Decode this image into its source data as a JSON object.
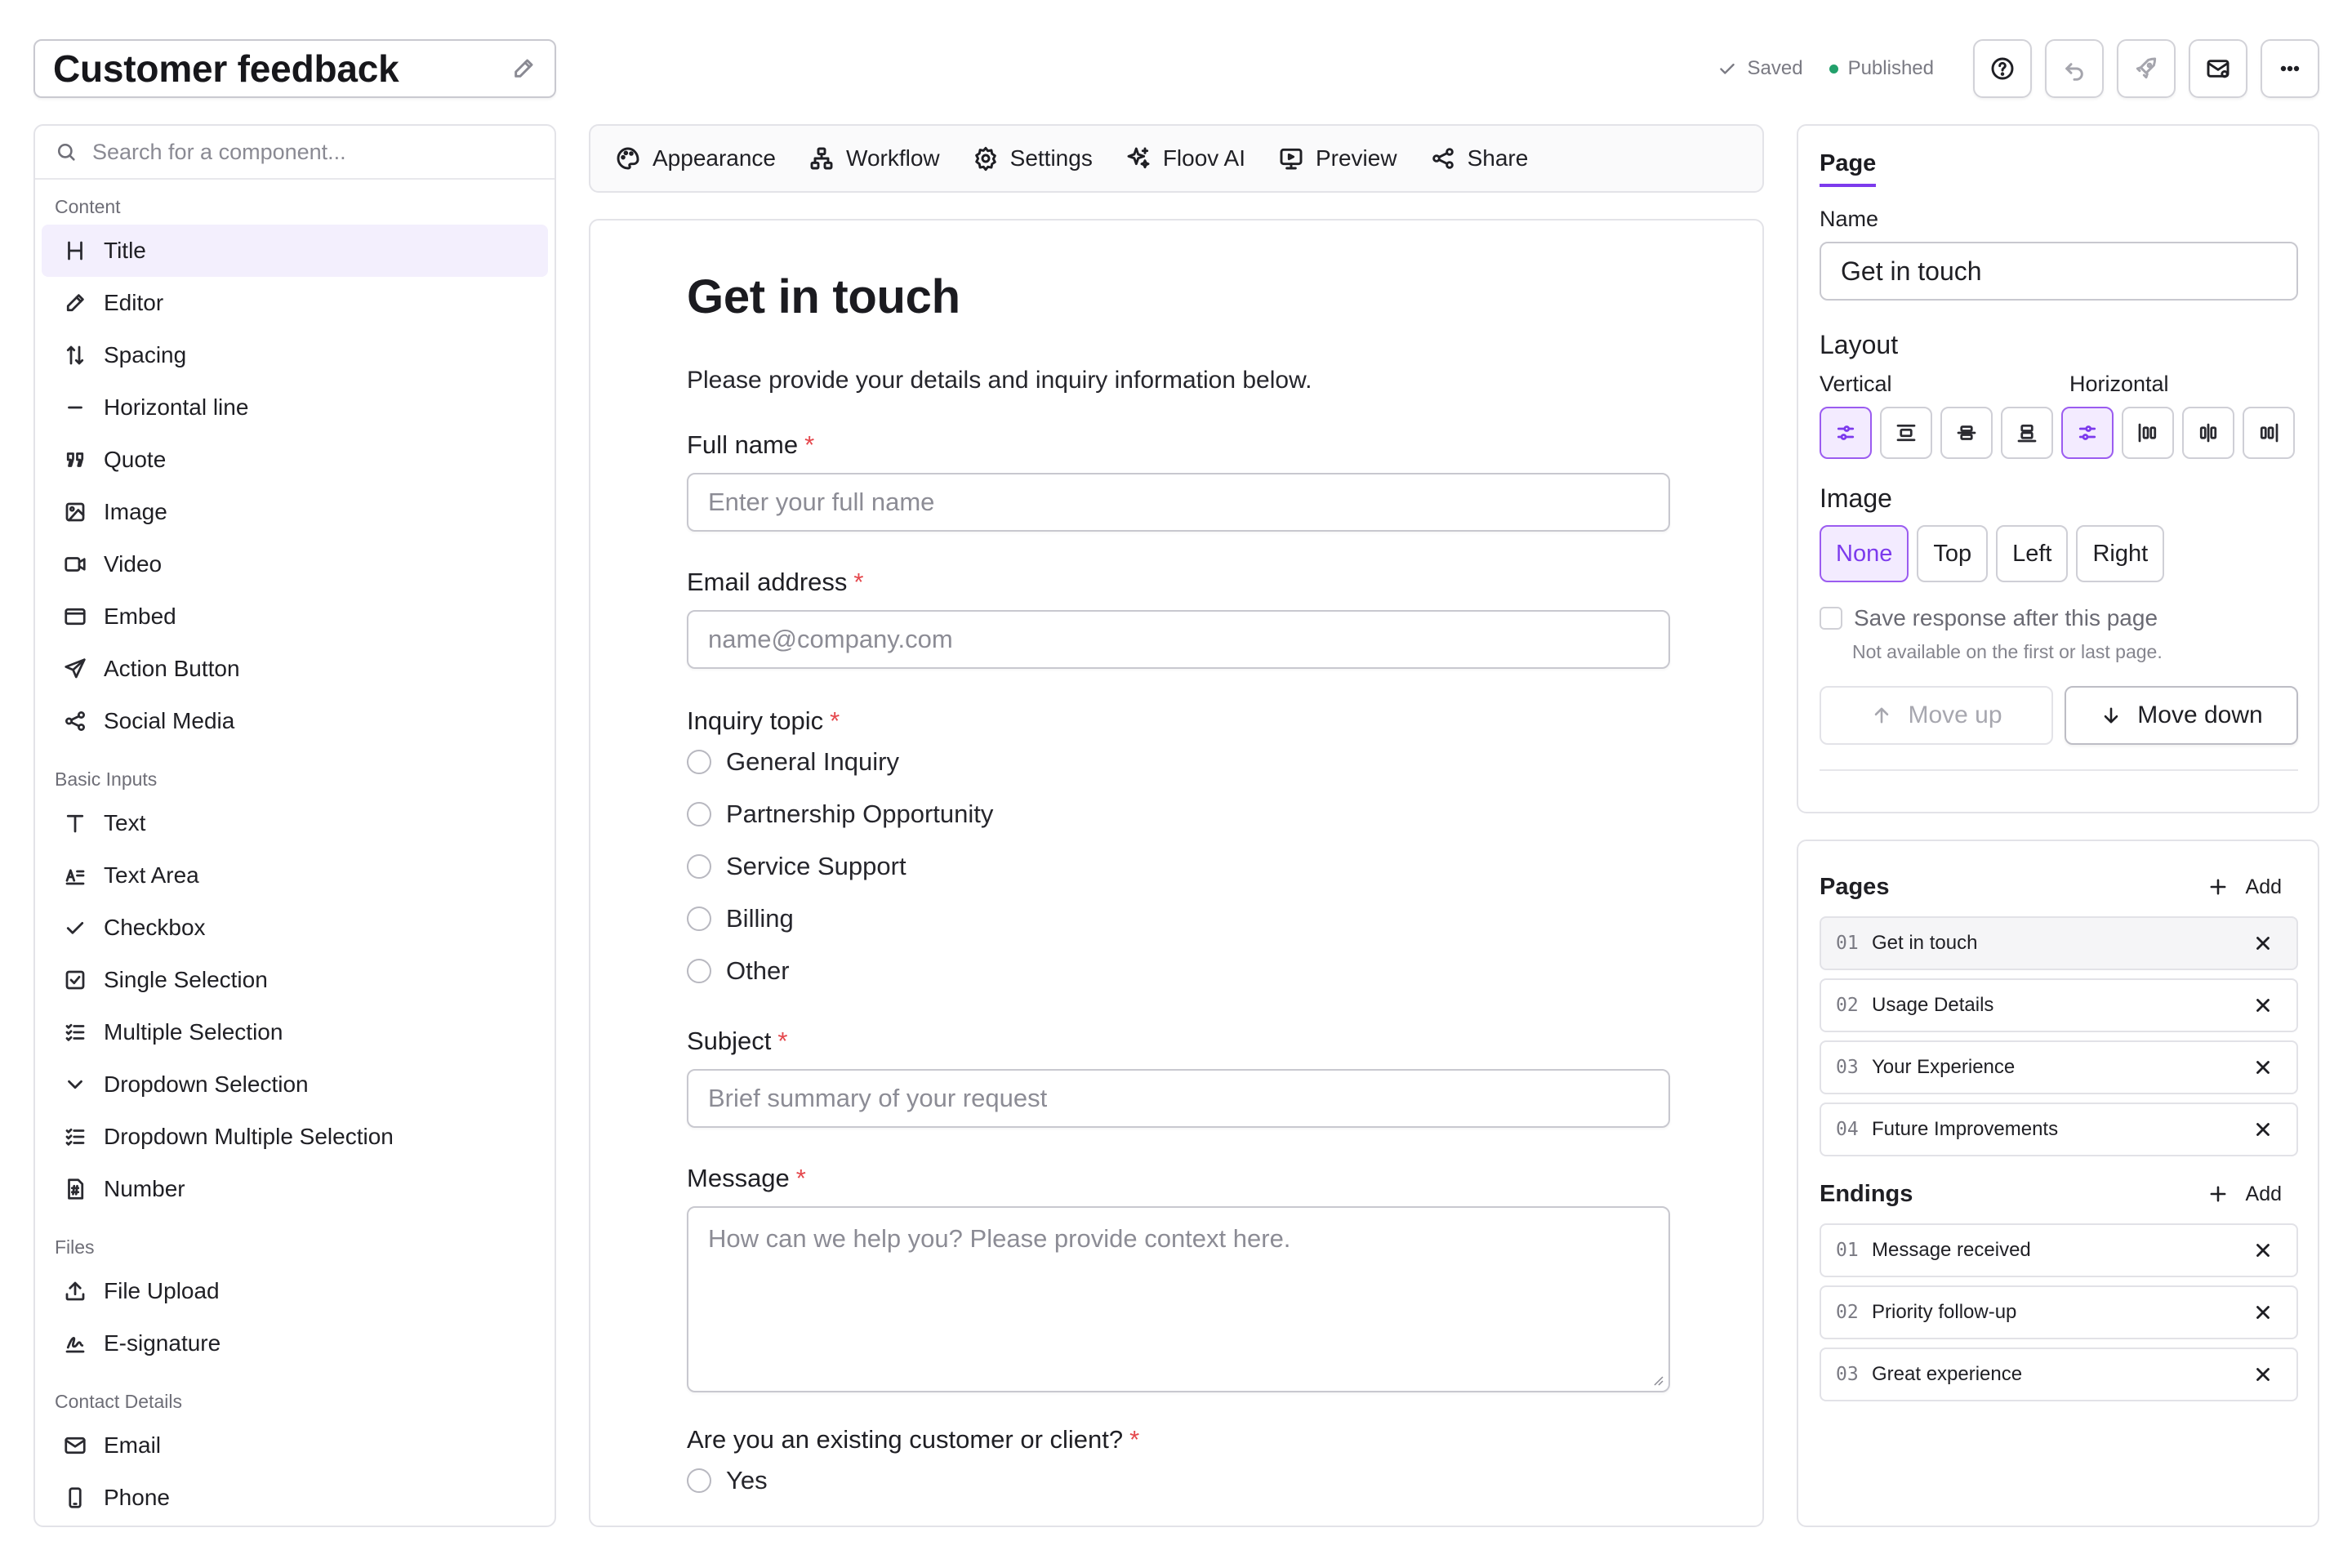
{
  "header": {
    "form_title": "Customer feedback",
    "saved_label": "Saved",
    "published_label": "Published"
  },
  "components": {
    "search_placeholder": "Search for a component...",
    "sections": [
      {
        "title": "Content",
        "items": [
          {
            "label": "Title",
            "icon": "heading-icon"
          },
          {
            "label": "Editor",
            "icon": "pencil-icon"
          },
          {
            "label": "Spacing",
            "icon": "spacing-icon"
          },
          {
            "label": "Horizontal line",
            "icon": "horizontal-line-icon"
          },
          {
            "label": "Quote",
            "icon": "quote-icon"
          },
          {
            "label": "Image",
            "icon": "image-icon"
          },
          {
            "label": "Video",
            "icon": "video-icon"
          },
          {
            "label": "Embed",
            "icon": "embed-icon"
          },
          {
            "label": "Action Button",
            "icon": "send-icon"
          },
          {
            "label": "Social Media",
            "icon": "share-icon"
          }
        ]
      },
      {
        "title": "Basic Inputs",
        "items": [
          {
            "label": "Text",
            "icon": "text-icon"
          },
          {
            "label": "Text Area",
            "icon": "text-area-icon"
          },
          {
            "label": "Checkbox",
            "icon": "check-icon"
          },
          {
            "label": "Single Selection",
            "icon": "checkbox-icon"
          },
          {
            "label": "Multiple Selection",
            "icon": "list-check-icon"
          },
          {
            "label": "Dropdown Selection",
            "icon": "chevron-down-icon"
          },
          {
            "label": "Dropdown Multiple Selection",
            "icon": "list-check-icon"
          },
          {
            "label": "Number",
            "icon": "number-icon"
          }
        ]
      },
      {
        "title": "Files",
        "items": [
          {
            "label": "File Upload",
            "icon": "upload-icon"
          },
          {
            "label": "E-signature",
            "icon": "signature-icon"
          }
        ]
      },
      {
        "title": "Contact Details",
        "items": [
          {
            "label": "Email",
            "icon": "mail-icon"
          },
          {
            "label": "Phone",
            "icon": "phone-icon"
          }
        ]
      }
    ]
  },
  "toolbar": {
    "items": [
      {
        "label": "Appearance",
        "icon": "palette-icon"
      },
      {
        "label": "Workflow",
        "icon": "workflow-icon"
      },
      {
        "label": "Settings",
        "icon": "gear-icon"
      },
      {
        "label": "Floov AI",
        "icon": "sparkles-icon"
      },
      {
        "label": "Preview",
        "icon": "preview-icon"
      },
      {
        "label": "Share",
        "icon": "share-icon"
      }
    ]
  },
  "form": {
    "title": "Get in touch",
    "description": "Please provide your details and inquiry information below.",
    "required_mark": "*",
    "full_name_label": "Full name",
    "full_name_placeholder": "Enter your full name",
    "email_label": "Email address",
    "email_placeholder": "name@company.com",
    "topic_label": "Inquiry topic",
    "topic_options": [
      "General Inquiry",
      "Partnership Opportunity",
      "Service Support",
      "Billing",
      "Other"
    ],
    "subject_label": "Subject",
    "subject_placeholder": "Brief summary of your request",
    "message_label": "Message",
    "message_placeholder": "How can we help you? Please provide context here.",
    "existing_label": "Are you an existing customer or client?",
    "existing_options": [
      "Yes"
    ]
  },
  "page_props": {
    "tab": "Page",
    "name_label": "Name",
    "name_value": "Get in touch",
    "layout_label": "Layout",
    "vertical_label": "Vertical",
    "horizontal_label": "Horizontal",
    "image_label": "Image",
    "image_options": [
      "None",
      "Top",
      "Left",
      "Right"
    ],
    "image_selected": "None",
    "save_response_label": "Save response after this page",
    "save_response_hint": "Not available on the first or last page.",
    "move_up_label": "Move up",
    "move_down_label": "Move down"
  },
  "pages_panel": {
    "pages_title": "Pages",
    "endings_title": "Endings",
    "add_label": "Add",
    "pages": [
      {
        "num": "01",
        "name": "Get in touch"
      },
      {
        "num": "02",
        "name": "Usage Details"
      },
      {
        "num": "03",
        "name": "Your Experience"
      },
      {
        "num": "04",
        "name": "Future Improvements"
      }
    ],
    "endings": [
      {
        "num": "01",
        "name": "Message received"
      },
      {
        "num": "02",
        "name": "Priority follow-up"
      },
      {
        "num": "03",
        "name": "Great experience"
      }
    ]
  },
  "colors": {
    "accent": "#7c3aed",
    "published": "#22a06b",
    "required": "#e5484d"
  }
}
